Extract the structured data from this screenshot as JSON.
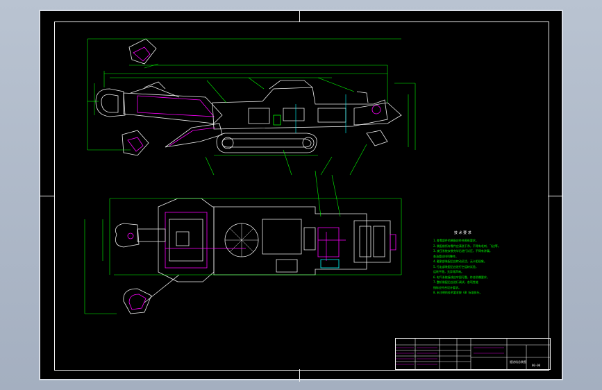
{
  "drawing": {
    "notes_title": "技 术 要 求",
    "notes": [
      "1.各零部件的装配应符合图纸要求。",
      "2.装配前所有零件应清洗干净，不得有毛刺、飞边等。",
      "3.液压系统安装完毕后进行试压，不得有渗漏。",
      "   各油管应排列整齐。",
      "4.截割部装配后应转动灵活，无卡阻现象。",
      "5.行走部装配后应进行空运转试验，",
      "   运转平稳，无异常声响。",
      "6.电气系统接线应牢固可靠，符合防爆要求。",
      "7.整机装配后应进行调试，各项性能",
      "   指标应符合设计要求。",
      "8.未注明的技术要求按 GB 标准执行。"
    ],
    "title_block": {
      "drawing_name": "掘进机总装图",
      "drawing_code": "00-00"
    }
  },
  "colors": {
    "background": "#000000",
    "outline": "#f0f0f0",
    "dimension": "#00ff00",
    "highlight": "#ff00ff",
    "accent": "#00ffff"
  }
}
